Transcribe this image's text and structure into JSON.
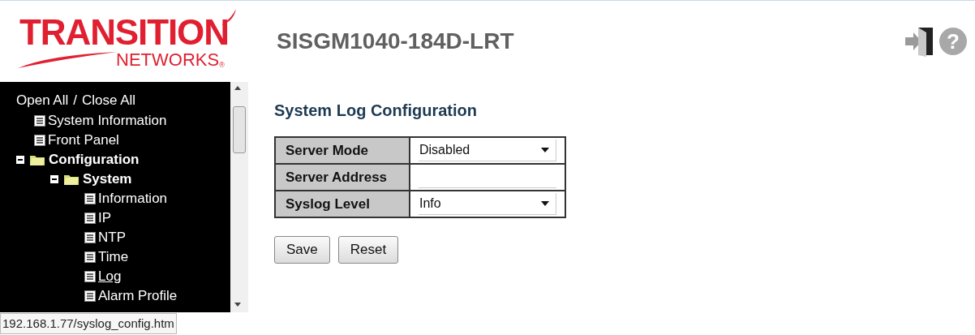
{
  "logo": {
    "line_1": "TRANSITION",
    "line_2": "NETWORKS",
    "mark": "®"
  },
  "device_title": "SISGM1040-184D-LRT",
  "header_icons": {
    "help_glyph": "?"
  },
  "sidebar": {
    "open_all": "Open All",
    "separator": "/",
    "close_all": "Close All",
    "tree": [
      {
        "label": "System Information",
        "kind": "page",
        "selected": false
      },
      {
        "label": "Front Panel",
        "kind": "page",
        "selected": false
      },
      {
        "label": "Configuration",
        "kind": "folder",
        "expanded": true,
        "selected": false,
        "children": [
          {
            "label": "System",
            "kind": "folder",
            "expanded": true,
            "selected": false,
            "children": [
              {
                "label": "Information",
                "kind": "page",
                "selected": false
              },
              {
                "label": "IP",
                "kind": "page",
                "selected": false
              },
              {
                "label": "NTP",
                "kind": "page",
                "selected": false
              },
              {
                "label": "Time",
                "kind": "page",
                "selected": false
              },
              {
                "label": "Log",
                "kind": "page",
                "selected": true
              },
              {
                "label": "Alarm Profile",
                "kind": "page",
                "selected": false
              }
            ]
          }
        ]
      }
    ]
  },
  "status_bar": {
    "url": "192.168.1.77/syslog_config.htm"
  },
  "form": {
    "title": "System Log Configuration",
    "rows": [
      {
        "label": "Server Mode",
        "kind": "select",
        "value": "Disabled"
      },
      {
        "label": "Server Address",
        "kind": "text"
      },
      {
        "label": "Syslog Level",
        "kind": "select",
        "value": "Info"
      }
    ],
    "buttons": [
      "Save",
      "Reset"
    ]
  }
}
